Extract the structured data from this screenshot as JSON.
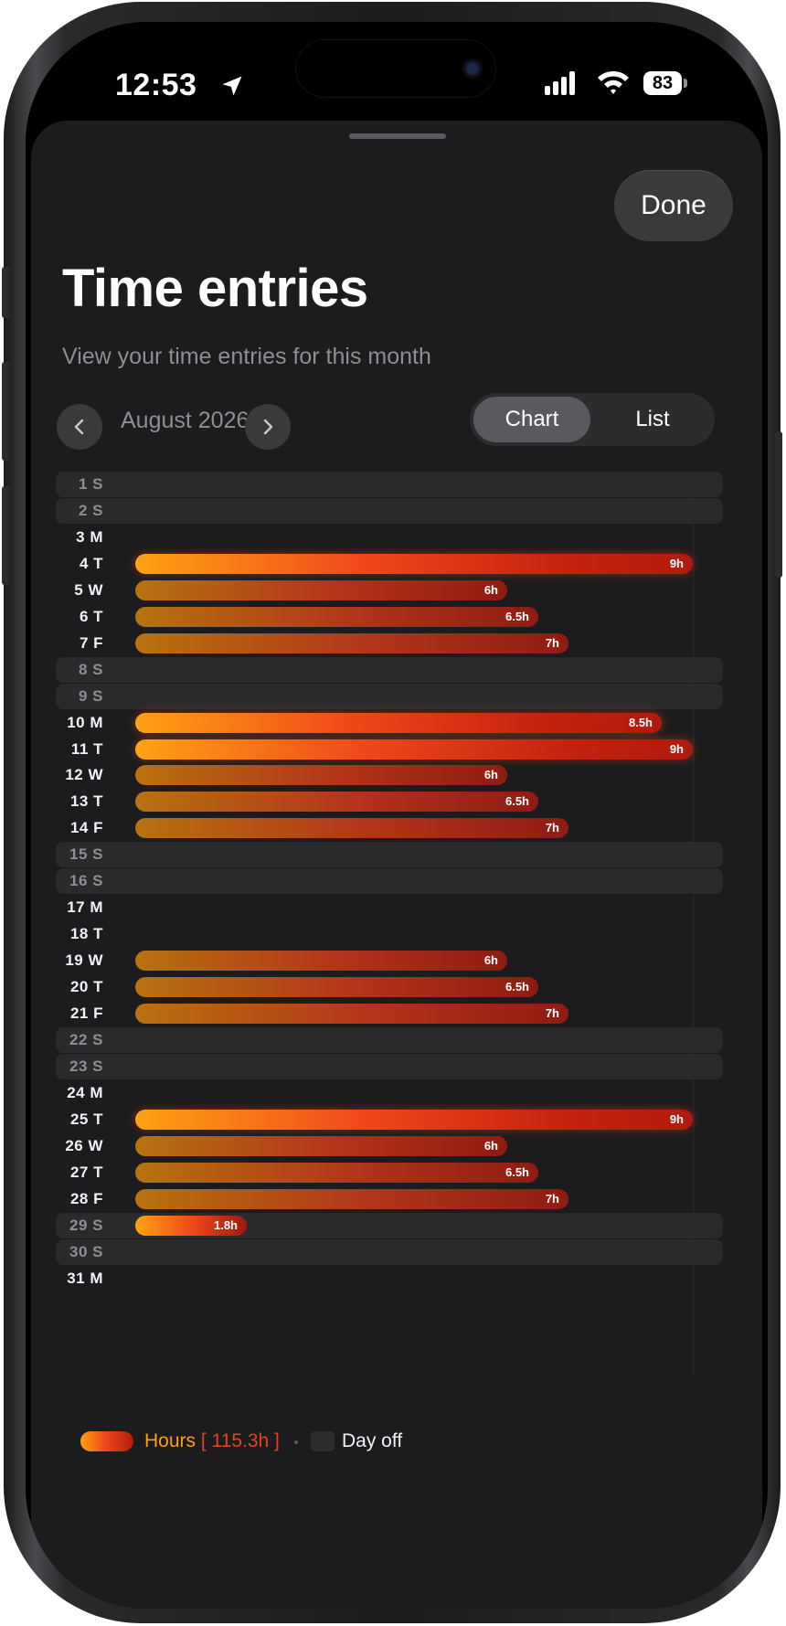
{
  "status_bar": {
    "time": "12:53",
    "battery": "83"
  },
  "header": {
    "done_label": "Done",
    "title": "Time entries",
    "subtitle": "View your time entries for this month"
  },
  "month_nav": {
    "label": "August 2026"
  },
  "view_toggle": {
    "options": [
      "Chart",
      "List"
    ],
    "selected": "Chart"
  },
  "colors": {
    "hours_start": "#ffa313",
    "hours_mid": "#f04a1b",
    "hours_end": "#b01a0e",
    "day_off": "#2a2a2c",
    "accent": "#ff9f0a"
  },
  "legend": {
    "hours_label": "Hours",
    "total_label": "[ 115.3h ]",
    "day_off_label": "Day off"
  },
  "chart_data": {
    "type": "bar",
    "orientation": "horizontal",
    "xlim": [
      0,
      9
    ],
    "days": [
      {
        "label": "1 S",
        "hours": null,
        "off": true
      },
      {
        "label": "2 S",
        "hours": null,
        "off": true
      },
      {
        "label": "3 M",
        "hours": null,
        "off": false
      },
      {
        "label": "4 T",
        "hours": 9,
        "value_label": "9h",
        "off": false
      },
      {
        "label": "5 W",
        "hours": 6,
        "value_label": "6h",
        "off": false
      },
      {
        "label": "6 T",
        "hours": 6.5,
        "value_label": "6.5h",
        "off": false
      },
      {
        "label": "7 F",
        "hours": 7,
        "value_label": "7h",
        "off": false
      },
      {
        "label": "8 S",
        "hours": null,
        "off": true
      },
      {
        "label": "9 S",
        "hours": null,
        "off": true
      },
      {
        "label": "10 M",
        "hours": 8.5,
        "value_label": "8.5h",
        "off": false
      },
      {
        "label": "11 T",
        "hours": 9,
        "value_label": "9h",
        "off": false
      },
      {
        "label": "12 W",
        "hours": 6,
        "value_label": "6h",
        "off": false
      },
      {
        "label": "13 T",
        "hours": 6.5,
        "value_label": "6.5h",
        "off": false
      },
      {
        "label": "14 F",
        "hours": 7,
        "value_label": "7h",
        "off": false
      },
      {
        "label": "15 S",
        "hours": null,
        "off": true
      },
      {
        "label": "16 S",
        "hours": null,
        "off": true
      },
      {
        "label": "17 M",
        "hours": null,
        "off": false
      },
      {
        "label": "18 T",
        "hours": null,
        "off": false
      },
      {
        "label": "19 W",
        "hours": 6,
        "value_label": "6h",
        "off": false
      },
      {
        "label": "20 T",
        "hours": 6.5,
        "value_label": "6.5h",
        "off": false
      },
      {
        "label": "21 F",
        "hours": 7,
        "value_label": "7h",
        "off": false
      },
      {
        "label": "22 S",
        "hours": null,
        "off": true
      },
      {
        "label": "23 S",
        "hours": null,
        "off": true
      },
      {
        "label": "24 M",
        "hours": null,
        "off": false
      },
      {
        "label": "25 T",
        "hours": 9,
        "value_label": "9h",
        "off": false
      },
      {
        "label": "26 W",
        "hours": 6,
        "value_label": "6h",
        "off": false
      },
      {
        "label": "27 T",
        "hours": 6.5,
        "value_label": "6.5h",
        "off": false
      },
      {
        "label": "28 F",
        "hours": 7,
        "value_label": "7h",
        "off": false
      },
      {
        "label": "29 S",
        "hours": 1.8,
        "value_label": "1.8h",
        "off": true
      },
      {
        "label": "30 S",
        "hours": null,
        "off": true
      },
      {
        "label": "31 M",
        "hours": null,
        "off": false
      }
    ]
  }
}
